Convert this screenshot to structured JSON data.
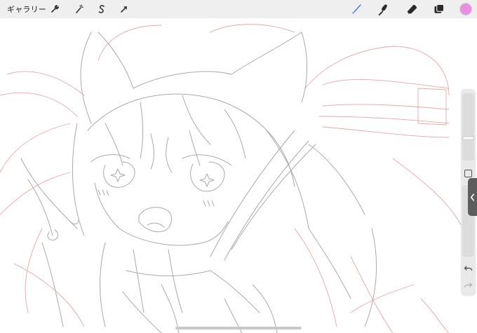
{
  "toolbar": {
    "gallery_label": "ギャラリー",
    "left_tools": [
      {
        "name": "actions-wrench-icon"
      },
      {
        "name": "adjustments-wand-icon"
      },
      {
        "name": "selection-icon"
      },
      {
        "name": "transform-arrow-icon"
      }
    ],
    "right_tools": [
      {
        "name": "brush-icon"
      },
      {
        "name": "smudge-icon"
      },
      {
        "name": "eraser-icon"
      },
      {
        "name": "layers-icon"
      }
    ],
    "current_color": "#ea8fe4",
    "accent_color": "#2f6df6"
  },
  "sidebar": {
    "brush_size_level": 0.49,
    "opacity_level": 0.0
  }
}
